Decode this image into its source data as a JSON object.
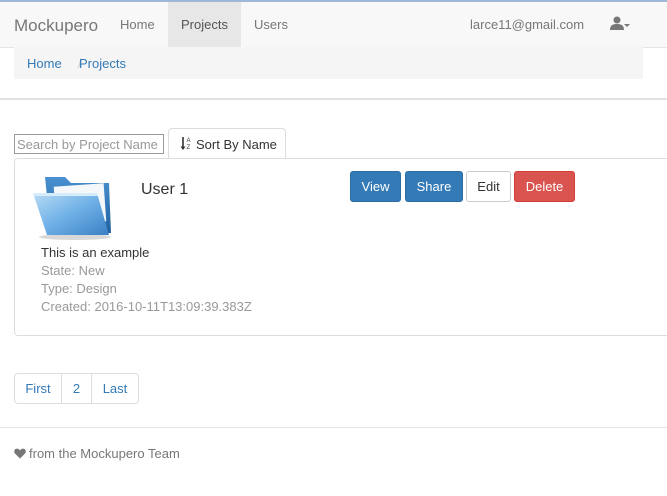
{
  "navbar": {
    "brand": "Mockupero",
    "links": [
      {
        "label": "Home"
      },
      {
        "label": "Projects",
        "active": true
      },
      {
        "label": "Users"
      }
    ],
    "user_email": "larce11@gmail.com",
    "user_icon": "user-icon"
  },
  "breadcrumb": {
    "items": [
      "Home",
      "Projects"
    ],
    "separator": "/"
  },
  "toolbar": {
    "search_placeholder": "Search by Project Name",
    "sort_label": "Sort By Name",
    "sort_icon": "sort-alpha-icon"
  },
  "project": {
    "name": "User 1",
    "icon": "folder-icon",
    "description": "This is an example",
    "state": "State: New",
    "type": "Type: Design",
    "created": "Created: 2016-10-11T13:09:39.383Z",
    "actions": {
      "view": "View",
      "share": "Share",
      "edit": "Edit",
      "delete": "Delete"
    }
  },
  "pagination": {
    "first": "First",
    "page": "2",
    "last": "Last"
  },
  "footer": {
    "text": "from the Mockupero Team",
    "icon": "heart-icon"
  },
  "colors": {
    "primary": "#337ab7",
    "danger": "#d9534f",
    "navbar_bg": "#f8f8f8",
    "muted": "#999999"
  }
}
